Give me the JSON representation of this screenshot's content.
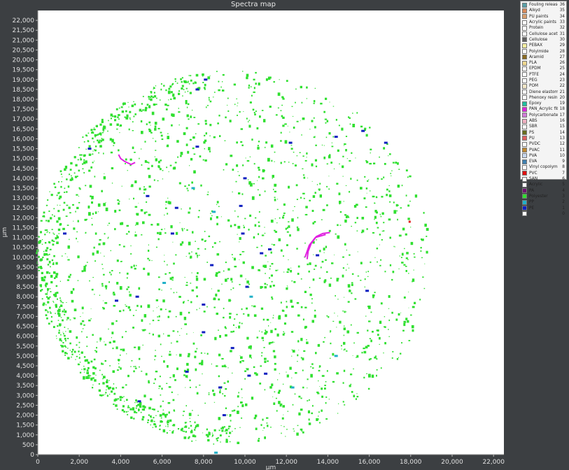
{
  "chart_data": {
    "type": "scatter",
    "title": "Spectra map",
    "xlabel": "µm",
    "ylabel": "µm",
    "xlim": [
      0,
      22500
    ],
    "ylim": [
      0,
      22500
    ],
    "x_ticks": [
      "0",
      "2,000",
      "4,000",
      "6,000",
      "8,000",
      "10,000",
      "12,000",
      "14,000",
      "16,000",
      "18,000",
      "20,000",
      "22,000"
    ],
    "x_tick_values": [
      0,
      2000,
      4000,
      6000,
      8000,
      10000,
      12000,
      14000,
      16000,
      18000,
      20000,
      22000
    ],
    "y_ticks": [
      "0",
      "500",
      "1,000",
      "1,500",
      "2,000",
      "2,500",
      "3,000",
      "3,500",
      "4,000",
      "4,500",
      "5,000",
      "5,500",
      "6,000",
      "6,500",
      "7,000",
      "7,500",
      "8,000",
      "8,500",
      "9,000",
      "9,500",
      "10,000",
      "10,500",
      "11,000",
      "11,500",
      "12,000",
      "12,500",
      "13,000",
      "13,500",
      "14,000",
      "14,500",
      "15,000",
      "15,500",
      "16,000",
      "16,500",
      "17,000",
      "17,500",
      "18,000",
      "18,500",
      "19,000",
      "19,500",
      "20,000",
      "20,500",
      "21,000",
      "21,500",
      "22,000"
    ],
    "y_tick_values": [
      0,
      500,
      1000,
      1500,
      2000,
      2500,
      3000,
      3500,
      4000,
      4500,
      5000,
      5500,
      6000,
      6500,
      7000,
      7500,
      8000,
      8500,
      9000,
      9500,
      10000,
      10500,
      11000,
      11500,
      12000,
      12500,
      13000,
      13500,
      14000,
      14500,
      15000,
      15500,
      16000,
      16500,
      17000,
      17500,
      18000,
      18500,
      19000,
      19500,
      20000,
      20500,
      21000,
      21500,
      22000
    ],
    "grid": false,
    "sample_region": {
      "center": [
        9400,
        10000
      ],
      "radius": 9500
    },
    "particles": [
      {
        "class": "PAN_Acrylic fibre",
        "path": [
          [
            3900,
            15200
          ],
          [
            4000,
            15000
          ],
          [
            4200,
            14850
          ],
          [
            4500,
            14700
          ],
          [
            4700,
            14800
          ]
        ]
      },
      {
        "class": "PAN_Acrylic fibre",
        "path": [
          [
            13000,
            9900
          ],
          [
            13050,
            10300
          ],
          [
            13200,
            10700
          ],
          [
            13450,
            11050
          ],
          [
            13750,
            11200
          ],
          [
            14100,
            11250
          ]
        ]
      },
      {
        "class": "PAN_Acrylic fibre",
        "path": [
          [
            12900,
            10000
          ],
          [
            13100,
            10600
          ],
          [
            13400,
            11000
          ],
          [
            13900,
            11150
          ]
        ]
      },
      {
        "class": "PE",
        "x": 10000,
        "y": 14000
      },
      {
        "class": "PE",
        "x": 5300,
        "y": 13100
      },
      {
        "class": "PE",
        "x": 6700,
        "y": 12500
      },
      {
        "class": "PE",
        "x": 9800,
        "y": 12600
      },
      {
        "class": "PE",
        "x": 6500,
        "y": 11200
      },
      {
        "class": "PE",
        "x": 9900,
        "y": 11200
      },
      {
        "class": "PE",
        "x": 10800,
        "y": 10200
      },
      {
        "class": "PE",
        "x": 11200,
        "y": 10400
      },
      {
        "class": "PE",
        "x": 13500,
        "y": 10100
      },
      {
        "class": "PE",
        "x": 8000,
        "y": 7600
      },
      {
        "class": "PE",
        "x": 10100,
        "y": 8500
      },
      {
        "class": "PE",
        "x": 8000,
        "y": 6200
      },
      {
        "class": "PE",
        "x": 10200,
        "y": 4000
      },
      {
        "class": "PE",
        "x": 11000,
        "y": 4100
      },
      {
        "class": "PE",
        "x": 9400,
        "y": 5400
      },
      {
        "class": "PE",
        "x": 4900,
        "y": 2700
      },
      {
        "class": "PE",
        "x": 8100,
        "y": 19000
      },
      {
        "class": "PE",
        "x": 7700,
        "y": 18500
      },
      {
        "class": "PE",
        "x": 15700,
        "y": 16400
      },
      {
        "class": "PE",
        "x": 16800,
        "y": 15800
      },
      {
        "class": "PE",
        "x": 14400,
        "y": 16100
      },
      {
        "class": "PE",
        "x": 8400,
        "y": 9600
      },
      {
        "class": "PE",
        "x": 1300,
        "y": 11200
      },
      {
        "class": "PE",
        "x": 2500,
        "y": 15500
      },
      {
        "class": "PE",
        "x": 12200,
        "y": 15800
      },
      {
        "class": "PE",
        "x": 15900,
        "y": 8300
      },
      {
        "class": "PE",
        "x": 4800,
        "y": 8000
      },
      {
        "class": "PE",
        "x": 8800,
        "y": 3400
      },
      {
        "class": "PE",
        "x": 9000,
        "y": 2000
      },
      {
        "class": "PE",
        "x": 7200,
        "y": 4200
      },
      {
        "class": "PE",
        "x": 3800,
        "y": 7800
      },
      {
        "class": "PE",
        "x": 7700,
        "y": 15600
      },
      {
        "class": "PP",
        "x": 8500,
        "y": 12300
      },
      {
        "class": "PP",
        "x": 7500,
        "y": 13500
      },
      {
        "class": "PP",
        "x": 10300,
        "y": 8000
      },
      {
        "class": "PP",
        "x": 14400,
        "y": 5000
      },
      {
        "class": "PP",
        "x": 12300,
        "y": 3400
      },
      {
        "class": "PP",
        "x": 8600,
        "y": 100
      },
      {
        "class": "PP",
        "x": 6100,
        "y": 8700
      },
      {
        "class": "PVC",
        "x": 17950,
        "y": 11800
      }
    ]
  },
  "legend": [
    {
      "name": "Fouling release",
      "code": "36",
      "color": "#5aa0a8"
    },
    {
      "name": "Alkyd",
      "code": "35",
      "color": "#d88a5a"
    },
    {
      "name": "PU paints",
      "code": "34",
      "color": "#d8a070"
    },
    {
      "name": "Acrylic paints",
      "code": "33",
      "color": "#ffffff"
    },
    {
      "name": "Protein",
      "code": "32",
      "color": "#ffffff"
    },
    {
      "name": "Cellulose acetate",
      "code": "31",
      "color": "#ffffff"
    },
    {
      "name": "Cellulose",
      "code": "30",
      "color": "#606060"
    },
    {
      "name": "PEBAX",
      "code": "29",
      "color": "#f8f0a0"
    },
    {
      "name": "Polyimide",
      "code": "28",
      "color": "#ffffff"
    },
    {
      "name": "Aramid",
      "code": "27",
      "color": "#8a6a20"
    },
    {
      "name": "PLA",
      "code": "26",
      "color": "#f0d890"
    },
    {
      "name": "EPDM",
      "code": "25",
      "color": "#ffffff"
    },
    {
      "name": "PTFE",
      "code": "24",
      "color": "#ffffff"
    },
    {
      "name": "PEG",
      "code": "23",
      "color": "#ffffff"
    },
    {
      "name": "POM",
      "code": "22",
      "color": "#f4e8c8"
    },
    {
      "name": "Diene elastomer",
      "code": "21",
      "color": "#ffffff"
    },
    {
      "name": "Phenoxy resin",
      "code": "20",
      "color": "#ffffff"
    },
    {
      "name": "Epoxy",
      "code": "19",
      "color": "#20c0a0"
    },
    {
      "name": "PAN_Acrylic fibre",
      "code": "18",
      "color": "#e020e0"
    },
    {
      "name": "Polycarbonate",
      "code": "17",
      "color": "#d07ad8"
    },
    {
      "name": "ABS",
      "code": "16",
      "color": "#f0b0c0"
    },
    {
      "name": "SBR",
      "code": "15",
      "color": "#ffffff"
    },
    {
      "name": "PS",
      "code": "14",
      "color": "#6a7020"
    },
    {
      "name": "PU",
      "code": "13",
      "color": "#e06060"
    },
    {
      "name": "PVDC",
      "code": "12",
      "color": "#ffffff"
    },
    {
      "name": "PVAC",
      "code": "11",
      "color": "#c08830"
    },
    {
      "name": "PVA",
      "code": "10",
      "color": "#c8d8f0"
    },
    {
      "name": "EVA",
      "code": "9",
      "color": "#4080b0"
    },
    {
      "name": "Vinyl copolymer",
      "code": "8",
      "color": "#ffffff"
    },
    {
      "name": "PVC",
      "code": "7",
      "color": "#e01010"
    },
    {
      "name": "SAN",
      "code": "6",
      "color": "#ffffff"
    },
    {
      "name": "Acrylic",
      "code": "5",
      "color": "#ffffff"
    },
    {
      "name": "PA",
      "code": "4",
      "color": "#701070"
    },
    {
      "name": "Polyester",
      "code": "3",
      "color": "#30e030"
    },
    {
      "name": "PP",
      "code": "2",
      "color": "#20b0c8"
    },
    {
      "name": "PE",
      "code": "1",
      "color": "#1020c0"
    },
    {
      "name": "",
      "code": "0",
      "color": "#ffffff"
    }
  ]
}
